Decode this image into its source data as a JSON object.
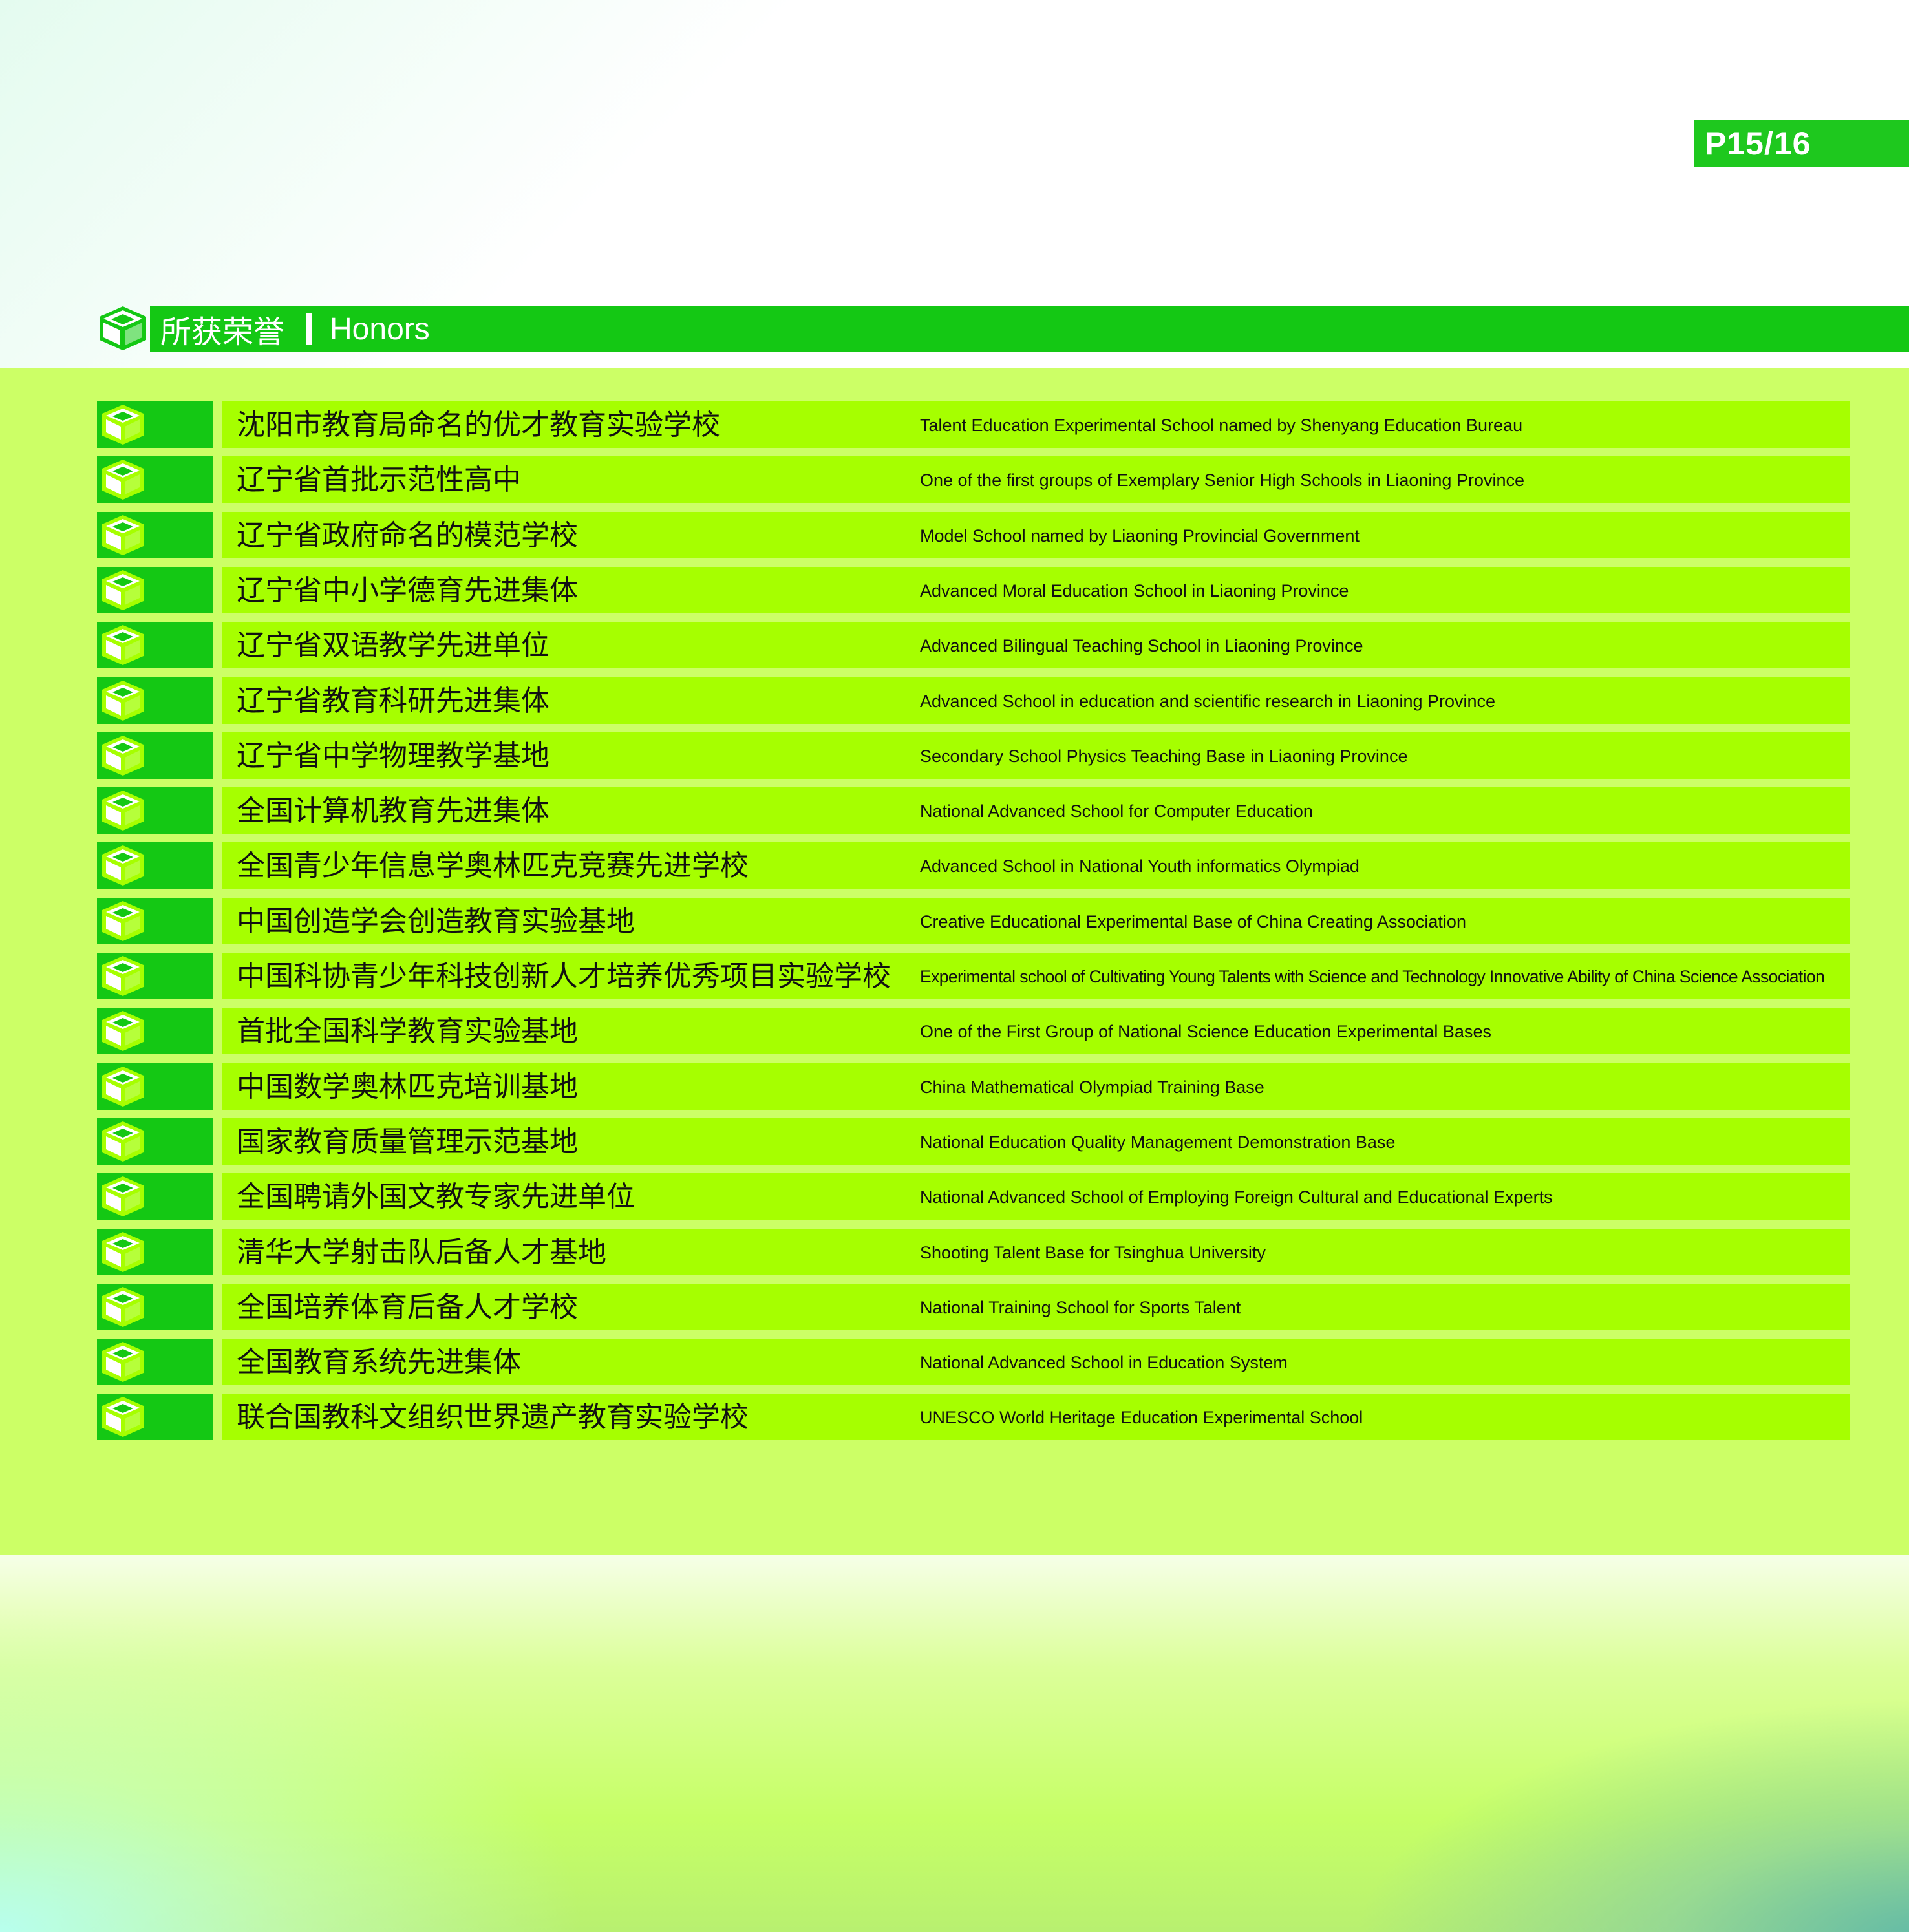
{
  "page_number": "P15/16",
  "header": {
    "title_cn": "所获荣誉",
    "title_en": "Honors"
  },
  "honors": [
    {
      "cn": "沈阳市教育局命名的优才教育实验学校",
      "en": "Talent Education Experimental School named by Shenyang Education Bureau"
    },
    {
      "cn": "辽宁省首批示范性高中",
      "en": "One of the first groups of Exemplary Senior High Schools in Liaoning Province"
    },
    {
      "cn": "辽宁省政府命名的模范学校",
      "en": "Model School named by Liaoning Provincial Government"
    },
    {
      "cn": "辽宁省中小学德育先进集体",
      "en": "Advanced Moral Education School in Liaoning Province"
    },
    {
      "cn": "辽宁省双语教学先进单位",
      "en": "Advanced Bilingual Teaching School in Liaoning Province"
    },
    {
      "cn": "辽宁省教育科研先进集体",
      "en": "Advanced School in education and scientific research in Liaoning Province"
    },
    {
      "cn": "辽宁省中学物理教学基地",
      "en": "Secondary School Physics Teaching Base in Liaoning Province"
    },
    {
      "cn": "全国计算机教育先进集体",
      "en": "National Advanced School for Computer Education"
    },
    {
      "cn": "全国青少年信息学奥林匹克竞赛先进学校",
      "en": "Advanced School in National Youth informatics Olympiad"
    },
    {
      "cn": "中国创造学会创造教育实验基地",
      "en": "Creative Educational Experimental Base of China Creating Association"
    },
    {
      "cn": "中国科协青少年科技创新人才培养优秀项目实验学校",
      "en": "Experimental school of Cultivating Young Talents with Science and Technology Innovative Ability of China Science Association"
    },
    {
      "cn": "首批全国科学教育实验基地",
      "en": "One of the First Group of National Science Education Experimental Bases"
    },
    {
      "cn": "中国数学奥林匹克培训基地",
      "en": "China Mathematical Olympiad Training Base"
    },
    {
      "cn": "国家教育质量管理示范基地",
      "en": "National Education Quality Management Demonstration Base"
    },
    {
      "cn": "全国聘请外国文教专家先进单位",
      "en": "National Advanced School of Employing Foreign Cultural and Educational Experts"
    },
    {
      "cn": "清华大学射击队后备人才基地",
      "en": "Shooting Talent Base for Tsinghua University"
    },
    {
      "cn": "全国培养体育后备人才学校",
      "en": "National Training School for Sports Talent"
    },
    {
      "cn": "全国教育系统先进集体",
      "en": "National Advanced School  in Education System"
    },
    {
      "cn": "联合国教科文组织世界遗产教育实验学校",
      "en": "UNESCO World Heritage Education Experimental School"
    }
  ]
}
